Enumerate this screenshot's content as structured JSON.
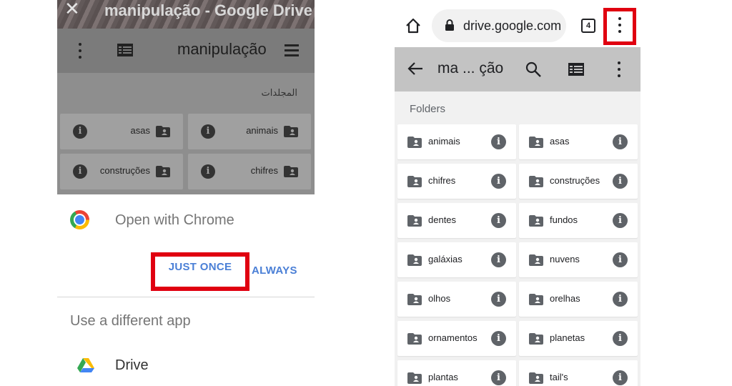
{
  "left": {
    "window_title": "manipulação - Google Drive",
    "toolbar_title": "manipulação",
    "folders_label": "المجلدات",
    "folders": [
      {
        "name": "asas"
      },
      {
        "name": "animais"
      },
      {
        "name": "construções"
      },
      {
        "name": "chifres"
      }
    ],
    "chooser": {
      "open_with": "Open with Chrome",
      "just_once": "JUST ONCE",
      "always": "ALWAYS",
      "different_app": "Use a different app",
      "app_name": "Drive"
    }
  },
  "right": {
    "url": "drive.google.com",
    "tab_count": "4",
    "toolbar_title": "ma ... ção",
    "folders_label": "Folders",
    "folders": [
      {
        "name": "animais"
      },
      {
        "name": "asas"
      },
      {
        "name": "chifres"
      },
      {
        "name": "construções"
      },
      {
        "name": "dentes"
      },
      {
        "name": "fundos"
      },
      {
        "name": "galáxias"
      },
      {
        "name": "nuvens"
      },
      {
        "name": "olhos"
      },
      {
        "name": "orelhas"
      },
      {
        "name": "ornamentos"
      },
      {
        "name": "planetas"
      },
      {
        "name": "plantas"
      },
      {
        "name": "tail's"
      }
    ]
  },
  "icons": {
    "info_glyph": "i"
  },
  "colors": {
    "highlight": "#e00010",
    "button_blue": "#4a7fd6",
    "drive_toolbar": "#c3c3c3"
  }
}
